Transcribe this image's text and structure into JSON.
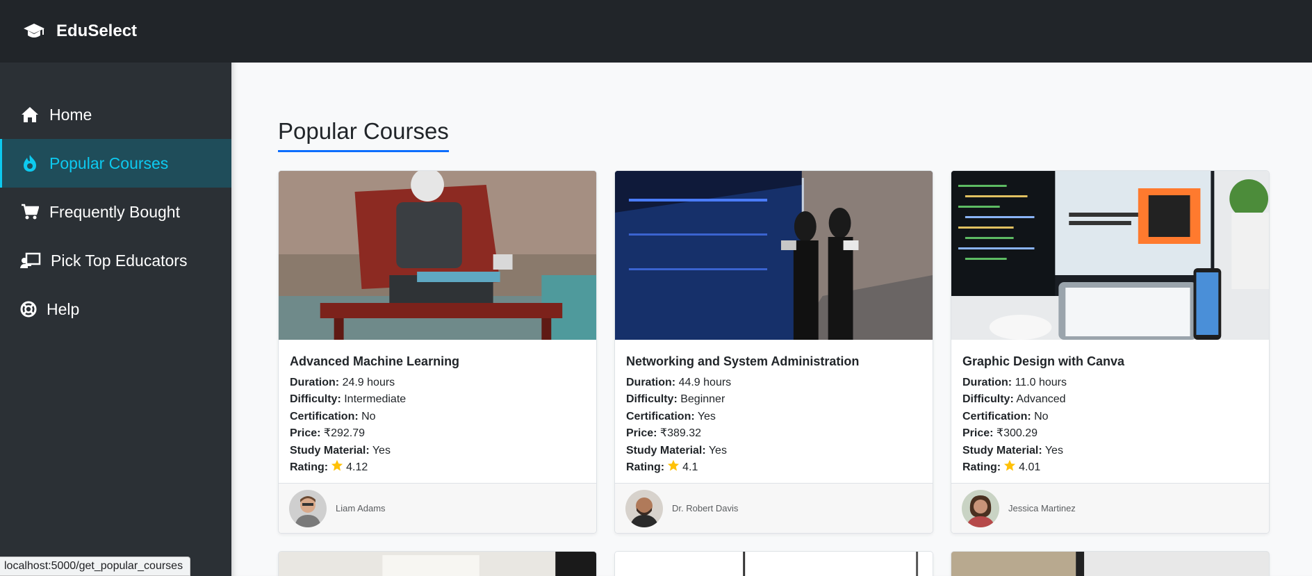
{
  "brand": {
    "name": "EduSelect",
    "icon": "graduation-cap-icon"
  },
  "sidebar": {
    "items": [
      {
        "label": "Home",
        "icon": "home-icon",
        "active": false
      },
      {
        "label": "Popular Courses",
        "icon": "fire-icon",
        "active": true
      },
      {
        "label": "Frequently Bought",
        "icon": "cart-icon",
        "active": false
      },
      {
        "label": "Pick Top Educators",
        "icon": "chalkboard-teacher-icon",
        "active": false
      },
      {
        "label": "Help",
        "icon": "life-ring-icon",
        "active": false
      }
    ]
  },
  "main": {
    "title": "Popular Courses",
    "field_labels": {
      "duration": "Duration:",
      "difficulty": "Difficulty:",
      "certification": "Certification:",
      "price": "Price:",
      "study_material": "Study Material:",
      "rating": "Rating:"
    },
    "courses": [
      {
        "title": "Advanced Machine Learning",
        "duration": "24.9 hours",
        "difficulty": "Intermediate",
        "certification": "No",
        "price": "₹292.79",
        "study_material": "Yes",
        "rating": "4.12",
        "educator": "Liam Adams",
        "image": "robot-on-bench-photo"
      },
      {
        "title": "Networking and System Administration",
        "duration": "44.9 hours",
        "difficulty": "Beginner",
        "certification": "Yes",
        "price": "₹389.32",
        "study_material": "Yes",
        "rating": "4.1",
        "educator": "Dr. Robert Davis",
        "image": "server-room-photo"
      },
      {
        "title": "Graphic Design with Canva",
        "duration": "11.0 hours",
        "difficulty": "Advanced",
        "certification": "No",
        "price": "₹300.29",
        "study_material": "Yes",
        "rating": "4.01",
        "educator": "Jessica Martinez",
        "image": "design-workstation-photo"
      }
    ]
  },
  "status_bar": {
    "url": "localhost:5000/get_popular_courses"
  },
  "colors": {
    "topbar": "#212529",
    "sidebar": "#2b3035",
    "active_bg": "#1f4d5a",
    "accent": "#0dcaf0",
    "title_underline": "#0d6efd",
    "star": "#ffc107"
  }
}
